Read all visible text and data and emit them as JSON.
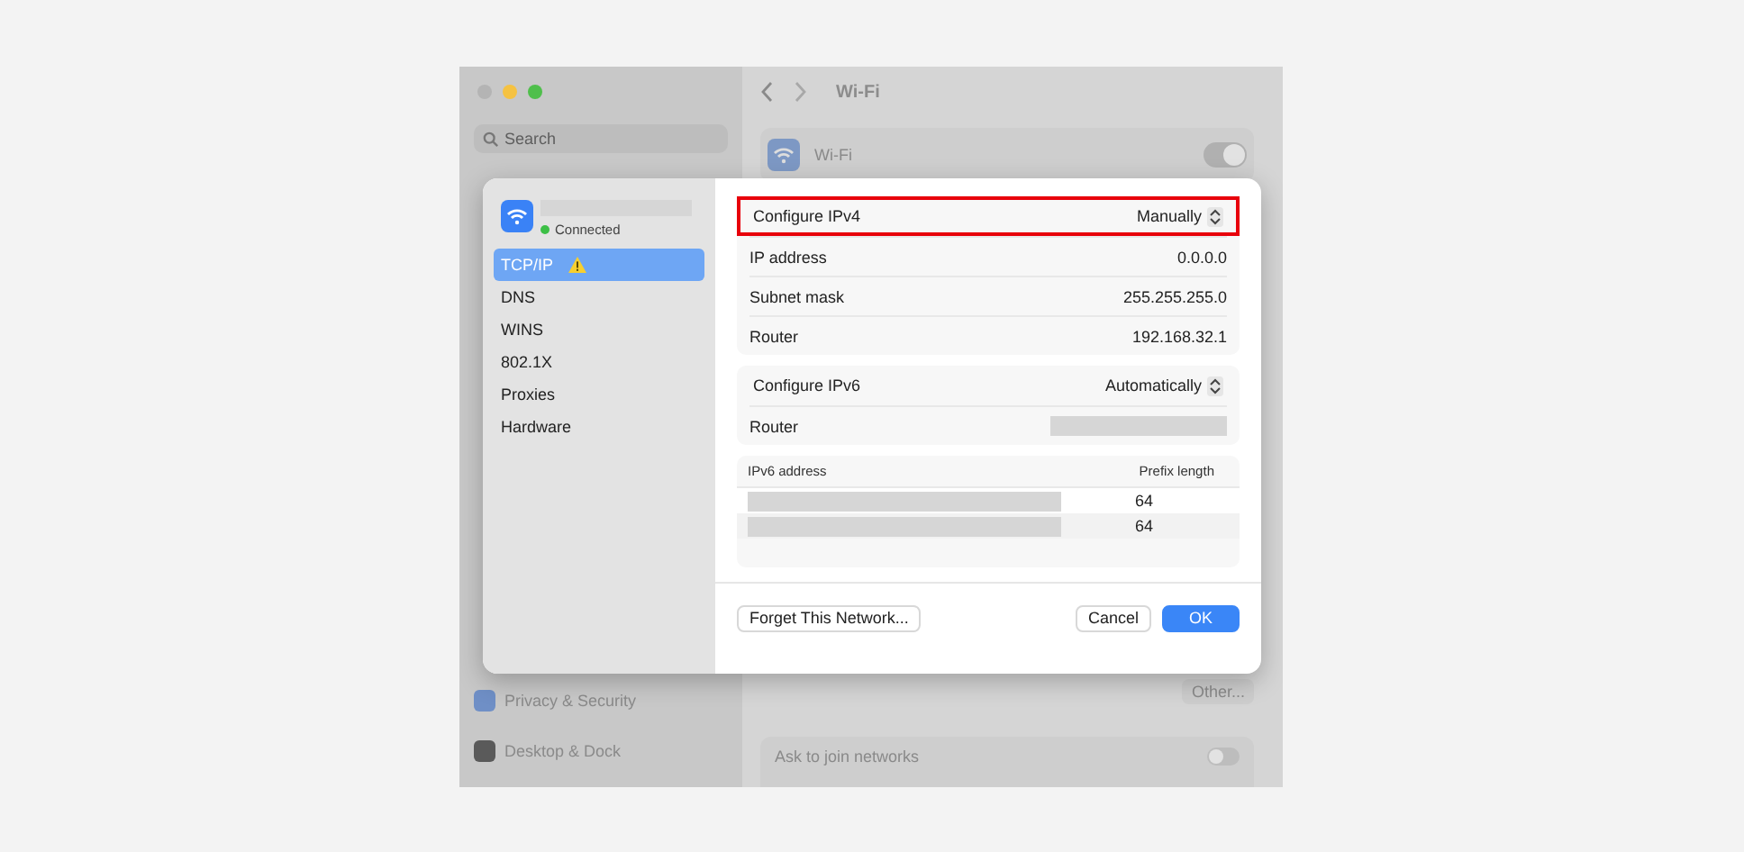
{
  "window": {
    "controls": [
      {
        "color": "#b4b4b4"
      },
      {
        "color": "#f5c242"
      },
      {
        "color": "#4fbf4b"
      }
    ]
  },
  "search": {
    "placeholder": "Search"
  },
  "sidebar": {
    "items": [
      {
        "label": "Privacy & Security",
        "color": "#6f8fc6"
      },
      {
        "label": "Desktop & Dock",
        "color": "#5a5a5a"
      }
    ]
  },
  "page": {
    "title": "Wi-Fi",
    "wifi": {
      "label": "Wi-Fi",
      "on": true
    },
    "other_button": "Other...",
    "ask_to_join": {
      "label": "Ask to join networks",
      "on": false
    }
  },
  "dialog": {
    "network": {
      "status": "Connected",
      "connected": true
    },
    "tabs": [
      {
        "label": "TCP/IP",
        "selected": true,
        "warning": true
      },
      {
        "label": "DNS",
        "selected": false,
        "warning": false
      },
      {
        "label": "WINS",
        "selected": false,
        "warning": false
      },
      {
        "label": "802.1X",
        "selected": false,
        "warning": false
      },
      {
        "label": "Proxies",
        "selected": false,
        "warning": false
      },
      {
        "label": "Hardware",
        "selected": false,
        "warning": false
      }
    ],
    "ipv4": {
      "label": "Configure IPv4",
      "value": "Manually",
      "highlighted": true
    },
    "ipv4_rows": [
      {
        "label": "IP address",
        "value": "0.0.0.0"
      },
      {
        "label": "Subnet mask",
        "value": "255.255.255.0"
      },
      {
        "label": "Router",
        "value": "192.168.32.1"
      }
    ],
    "ipv6": {
      "label": "Configure IPv6",
      "value": "Automatically",
      "highlighted": false
    },
    "ipv6_router": {
      "label": "Router"
    },
    "ipv6_table": {
      "columns": [
        "IPv6 address",
        "Prefix length"
      ],
      "rows": [
        {
          "prefix": "64"
        },
        {
          "prefix": "64"
        }
      ]
    },
    "buttons": {
      "forget": "Forget This Network...",
      "cancel": "Cancel",
      "ok": "OK"
    }
  }
}
